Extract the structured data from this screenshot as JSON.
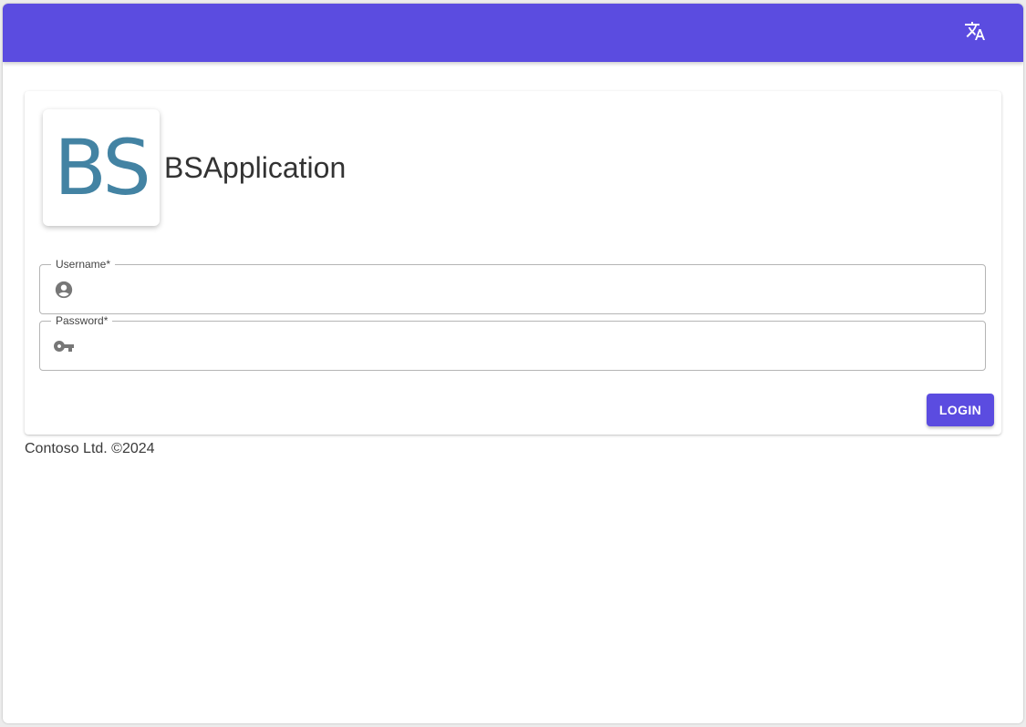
{
  "app": {
    "logo_text": "BS",
    "title": "BSApplication"
  },
  "toolbar": {
    "translate_icon": "translate-icon"
  },
  "form": {
    "username": {
      "label": "Username*",
      "icon": "account-circle-icon",
      "value": ""
    },
    "password": {
      "label": "Password*",
      "icon": "key-icon",
      "value": ""
    },
    "login_label": "LOGIN"
  },
  "footer": {
    "text": "Contoso Ltd. ©2024"
  },
  "colors": {
    "primary": "#5b4ce0",
    "logo": "#4383a3"
  }
}
